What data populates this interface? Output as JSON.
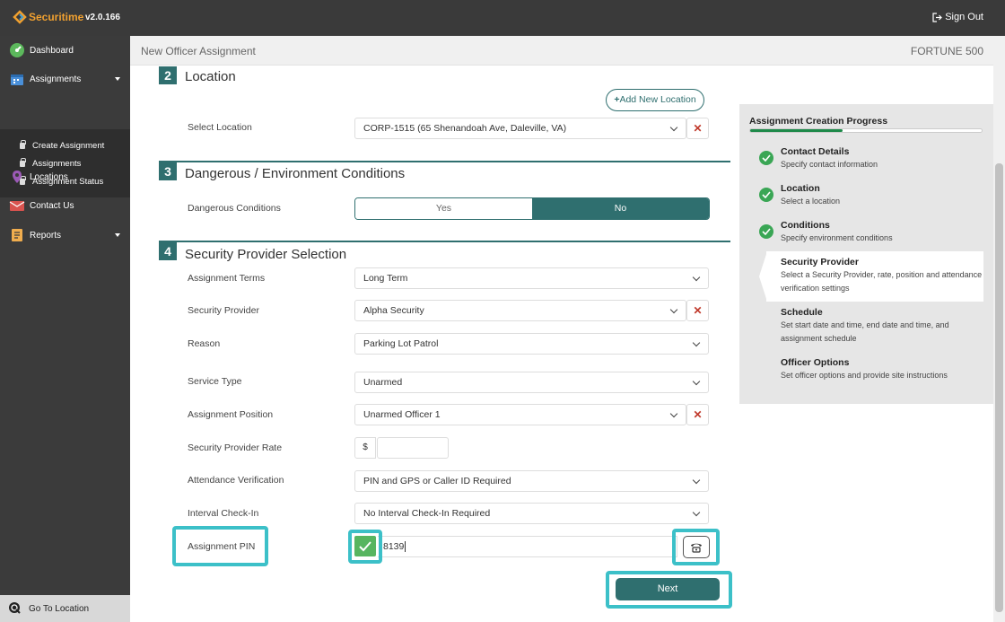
{
  "topbar": {
    "brand": "Securitime",
    "version": "v2.0.166",
    "signout": "Sign Out"
  },
  "sidebar": {
    "items": [
      {
        "label": "Dashboard",
        "icon": "dashboard-icon"
      },
      {
        "label": "Assignments",
        "icon": "calendar-icon"
      },
      {
        "label": "Locations",
        "icon": "map-pin-icon"
      },
      {
        "label": "Contact Us",
        "icon": "contact-icon"
      },
      {
        "label": "Reports",
        "icon": "reports-icon"
      }
    ],
    "sub_items": [
      "Create Assignment",
      "Assignments",
      "Assignment Status"
    ],
    "go_location": "Go To Location"
  },
  "header": {
    "title": "New Officer Assignment",
    "client": "FORTUNE 500"
  },
  "sections": {
    "location": {
      "num": "2",
      "title": "Location",
      "add_button": "Add New Location",
      "select_label": "Select Location",
      "select_value": "CORP-1515 (65 Shenandoah Ave, Daleville, VA)"
    },
    "conditions": {
      "num": "3",
      "title": "Dangerous / Environment Conditions",
      "label": "Dangerous Conditions",
      "yes": "Yes",
      "no": "No"
    },
    "provider": {
      "num": "4",
      "title": "Security Provider Selection",
      "terms_label": "Assignment Terms",
      "terms_value": "Long Term",
      "provider_label": "Security Provider",
      "provider_value": "Alpha Security",
      "reason_label": "Reason",
      "reason_value": "Parking Lot Patrol",
      "service_label": "Service Type",
      "service_value": "Unarmed",
      "position_label": "Assignment Position",
      "position_value": "Unarmed Officer 1",
      "rate_label": "Security Provider Rate",
      "rate_prefix": "$",
      "attendance_label": "Attendance Verification",
      "attendance_value": "PIN and GPS or Caller ID Required",
      "interval_label": "Interval Check-In",
      "interval_value": "No Interval Check-In Required",
      "pin_label": "Assignment PIN",
      "pin_value": "8139"
    }
  },
  "next_button": "Next",
  "progress": {
    "title": "Assignment Creation Progress",
    "fraction": 0.4,
    "steps": [
      {
        "title": "Contact Details",
        "desc": "Specify contact information",
        "done": true
      },
      {
        "title": "Location",
        "desc": "Select a location",
        "done": true
      },
      {
        "title": "Conditions",
        "desc": "Specify environment conditions",
        "done": true
      },
      {
        "title": "Security Provider",
        "desc": "Select a Security Provider, rate, position and attendance verification settings",
        "done": false
      },
      {
        "title": "Schedule",
        "desc": "Set start date and time, end date and time, and assignment schedule",
        "done": false
      },
      {
        "title": "Officer Options",
        "desc": "Set officer options and provide site instructions",
        "done": false
      }
    ]
  },
  "colors": {
    "accent": "#2f6f6f",
    "highlight": "#3cc0c8",
    "success": "#3aa655",
    "danger": "#c0392b"
  }
}
